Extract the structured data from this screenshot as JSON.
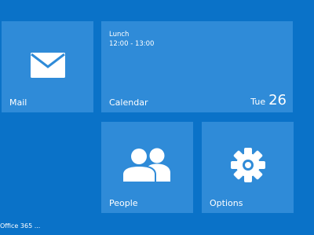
{
  "tiles": {
    "mail": {
      "label": "Mail",
      "icon": "envelope-icon"
    },
    "calendar": {
      "label": "Calendar",
      "event_title": "Lunch",
      "event_time": "12:00 - 13:00",
      "day_name": "Tue",
      "day_number": "26"
    },
    "people": {
      "label": "People",
      "icon": "people-icon"
    },
    "options": {
      "label": "Options",
      "icon": "gear-icon"
    }
  },
  "footer": {
    "text": "Office 365 ..."
  },
  "colors": {
    "background": "#0a72c8",
    "tile": "#2f8bd8",
    "text": "#ffffff"
  }
}
